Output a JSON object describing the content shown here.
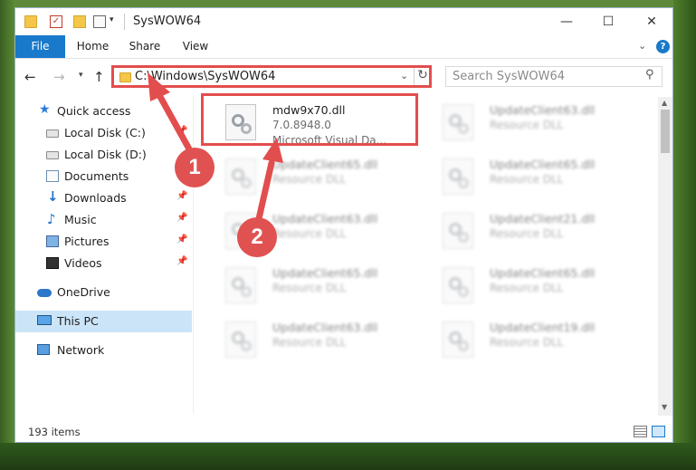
{
  "window": {
    "title": "SysWOW64"
  },
  "ribbon": {
    "tabs": [
      "File",
      "Home",
      "Share",
      "View"
    ],
    "help": "?"
  },
  "address": {
    "path": "C:\\Windows\\SysWOW64"
  },
  "search": {
    "placeholder": "Search SysWOW64"
  },
  "sidebar": {
    "items": [
      {
        "label": "Quick access",
        "icon": "star-icon"
      },
      {
        "label": "Local Disk (C:)",
        "icon": "drive-icon",
        "pinned": true
      },
      {
        "label": "Local Disk (D:)",
        "icon": "drive-icon"
      },
      {
        "label": "Documents",
        "icon": "documents-icon",
        "pinned": true
      },
      {
        "label": "Downloads",
        "icon": "download-icon",
        "pinned": true
      },
      {
        "label": "Music",
        "icon": "music-icon",
        "pinned": true
      },
      {
        "label": "Pictures",
        "icon": "pictures-icon",
        "pinned": true
      },
      {
        "label": "Videos",
        "icon": "videos-icon",
        "pinned": true
      },
      {
        "label": "OneDrive",
        "icon": "cloud-icon"
      },
      {
        "label": "This PC",
        "icon": "computer-icon",
        "selected": true
      },
      {
        "label": "Network",
        "icon": "network-icon"
      }
    ]
  },
  "files": [
    {
      "name": "mdw9x70.dll",
      "version": "7.0.8948.0",
      "description": "Microsoft Visual Da..."
    },
    {
      "name": "UpdateClient63.dll",
      "description": "Resource DLL"
    },
    {
      "name": "UpdateClient65.dll",
      "description": "Resource DLL"
    },
    {
      "name": "UpdateClient65.dll",
      "description": "Resource DLL"
    },
    {
      "name": "UpdateClient63.dll",
      "description": "Resource DLL"
    },
    {
      "name": "UpdateClient21.dll",
      "description": "Resource DLL"
    },
    {
      "name": "UpdateClient65.dll",
      "description": "Resource DLL"
    },
    {
      "name": "UpdateClient65.dll",
      "description": "Resource DLL"
    },
    {
      "name": "UpdateClient63.dll",
      "description": "Resource DLL"
    },
    {
      "name": "UpdateClient19.dll",
      "description": "Resource DLL"
    }
  ],
  "status": {
    "item_count": "193 items"
  },
  "annotations": {
    "marker1": "1",
    "marker2": "2"
  },
  "colors": {
    "accent": "#1979ca",
    "annotation": "#e24e4e"
  }
}
